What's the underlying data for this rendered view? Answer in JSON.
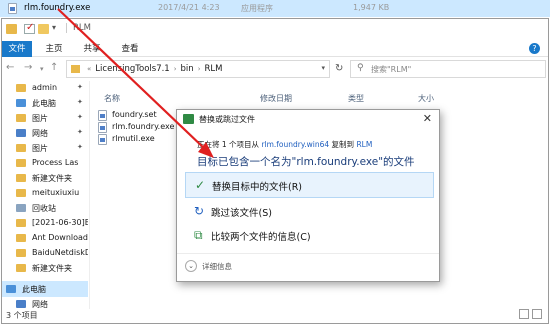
{
  "top_row": {
    "name": "rlm.foundry.exe",
    "date": "2017/4/21 4:23",
    "kind": "应用程序",
    "size": "1,947 KB"
  },
  "window": {
    "title": "RLM"
  },
  "ribbon": {
    "tabs": [
      "文件",
      "主页",
      "共享",
      "查看"
    ]
  },
  "address": {
    "crumbs": [
      "LicensingTools7.1",
      "bin",
      "RLM"
    ]
  },
  "search": {
    "placeholder": "搜索\"RLM\""
  },
  "sidebar": {
    "items": [
      {
        "label": "admin",
        "pinned": true,
        "icon": "folder-icon",
        "color": "#e8b84a"
      },
      {
        "label": "此电脑",
        "pinned": true,
        "icon": "computer-icon",
        "color": "#4a90d9"
      },
      {
        "label": "图片",
        "pinned": true,
        "icon": "pictures-icon",
        "color": "#e8b84a"
      },
      {
        "label": "网络",
        "pinned": true,
        "icon": "network-icon",
        "color": "#4a7fc8"
      },
      {
        "label": "图片",
        "pinned": true,
        "icon": "pictures-icon",
        "color": "#e8b84a"
      },
      {
        "label": "Process Las",
        "pinned": false,
        "icon": "folder-icon",
        "color": "#e8b84a"
      },
      {
        "label": "新建文件夹",
        "pinned": false,
        "icon": "folder-icon",
        "color": "#e8b84a"
      },
      {
        "label": "meituxiuxiu",
        "pinned": false,
        "icon": "folder-icon",
        "color": "#e8b84a"
      },
      {
        "label": "回收站",
        "pinned": false,
        "icon": "recycle-bin-icon",
        "color": "#8aa4c0"
      },
      {
        "label": "[2021-06-30]Be",
        "pinned": false,
        "icon": "folder-icon",
        "color": "#e8b84a"
      },
      {
        "label": "Ant Download",
        "pinned": false,
        "icon": "folder-icon",
        "color": "#e8b84a"
      },
      {
        "label": "BaiduNetdiskD",
        "pinned": false,
        "icon": "folder-icon",
        "color": "#e8b84a"
      },
      {
        "label": "新建文件夹",
        "pinned": false,
        "icon": "folder-icon",
        "color": "#e8b84a"
      },
      {
        "label": "此电脑",
        "pinned": false,
        "icon": "computer-icon",
        "color": "#4a90d9",
        "selected": true
      },
      {
        "label": "网络",
        "pinned": false,
        "icon": "network-icon",
        "color": "#4a7fc8"
      }
    ]
  },
  "list": {
    "headers": [
      "名称",
      "修改日期",
      "类型",
      "大小"
    ],
    "files": [
      "foundry.set",
      "rlm.foundry.exe",
      "rlmutil.exe"
    ]
  },
  "status": {
    "count": "3 个项目"
  },
  "dialog": {
    "title": "替换或跳过文件",
    "line_prefix": "正在将 1 个项目从",
    "line_source": "rlm.foundry.win64",
    "line_mid": "复制到",
    "line_dest": "RLM",
    "heading": "目标已包含一个名为\"rlm.foundry.exe\"的文件",
    "options": {
      "replace": "替换目标中的文件(R)",
      "skip": "跳过该文件(S)",
      "compare": "比较两个文件的信息(C)"
    },
    "details": "详细信息"
  },
  "colors": {
    "accent": "#1979ca",
    "selection": "#cce8ff",
    "annotation_arrow": "#e02020"
  }
}
